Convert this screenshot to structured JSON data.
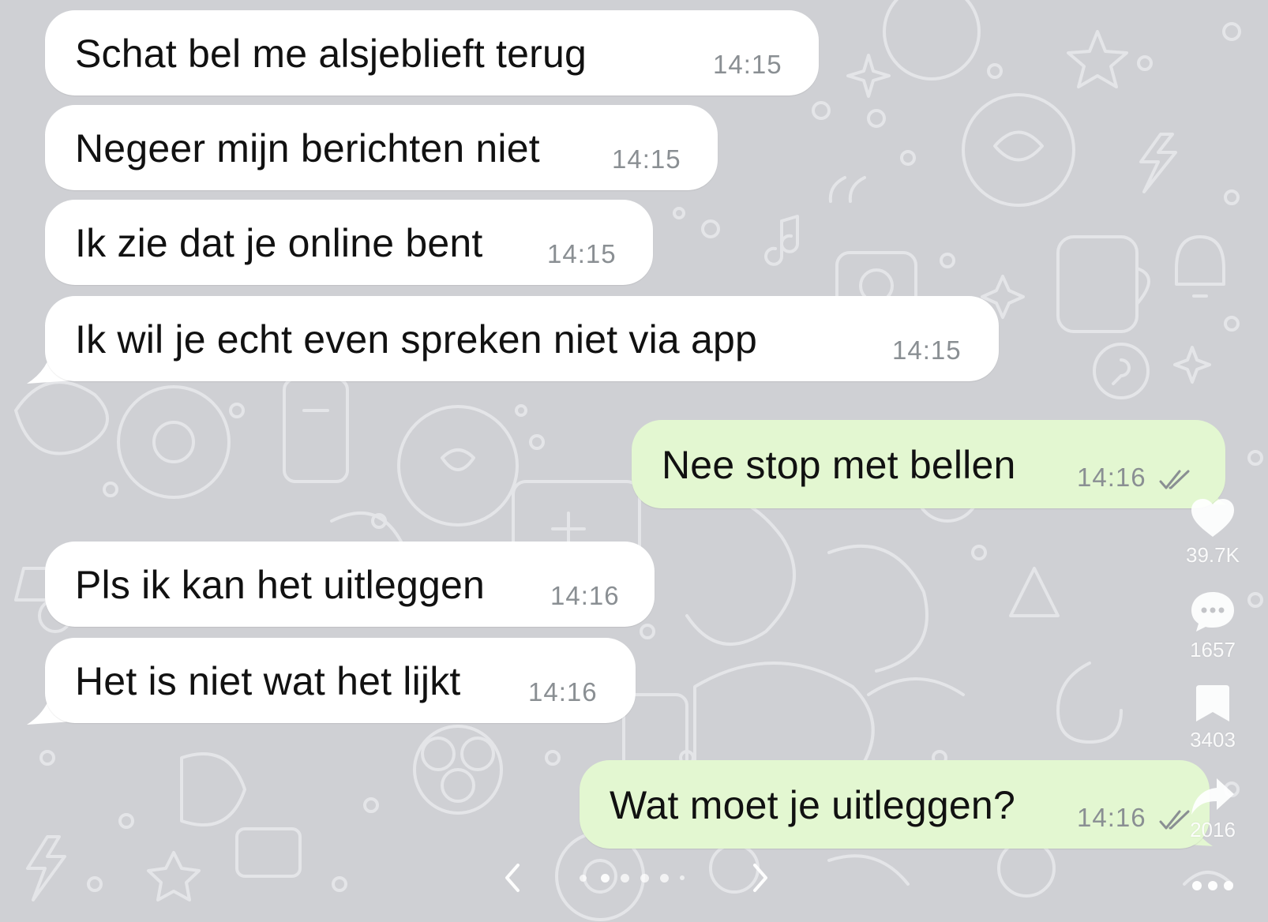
{
  "messages": [
    {
      "direction": "incoming",
      "text": "Schat bel me alsjeblieft terug",
      "time": "14:15"
    },
    {
      "direction": "incoming",
      "text": "Negeer mijn berichten niet",
      "time": "14:15"
    },
    {
      "direction": "incoming",
      "text": "Ik zie dat je online bent",
      "time": "14:15"
    },
    {
      "direction": "incoming",
      "text": "Ik wil je echt even spreken niet via app",
      "time": "14:15"
    },
    {
      "direction": "outgoing",
      "text": "Nee stop met bellen",
      "time": "14:16",
      "status": "read-ticks-icon"
    },
    {
      "direction": "incoming",
      "text": "Pls ik kan het uitleggen",
      "time": "14:16"
    },
    {
      "direction": "incoming",
      "text": "Het is niet wat het lijkt",
      "time": "14:16"
    },
    {
      "direction": "outgoing",
      "text": "Wat moet je uitleggen?",
      "time": "14:16",
      "status": "read-ticks-icon"
    }
  ],
  "actions": {
    "like": {
      "icon": "heart-icon",
      "count": "39.7K"
    },
    "comment": {
      "icon": "comment-bubble-icon",
      "count": "1657"
    },
    "save": {
      "icon": "bookmark-icon",
      "count": "3403"
    },
    "share": {
      "icon": "share-arrow-icon",
      "count": "2016"
    },
    "more": {
      "icon": "more-dots-icon"
    }
  },
  "carousel": {
    "total": 6,
    "active": 2
  },
  "colors": {
    "background": "#cfd0d4",
    "incoming_bubble": "#ffffff",
    "outgoing_bubble": "#e3f7d1",
    "timestamp": "#8a8f93",
    "overlay_icons": "#ffffff"
  }
}
